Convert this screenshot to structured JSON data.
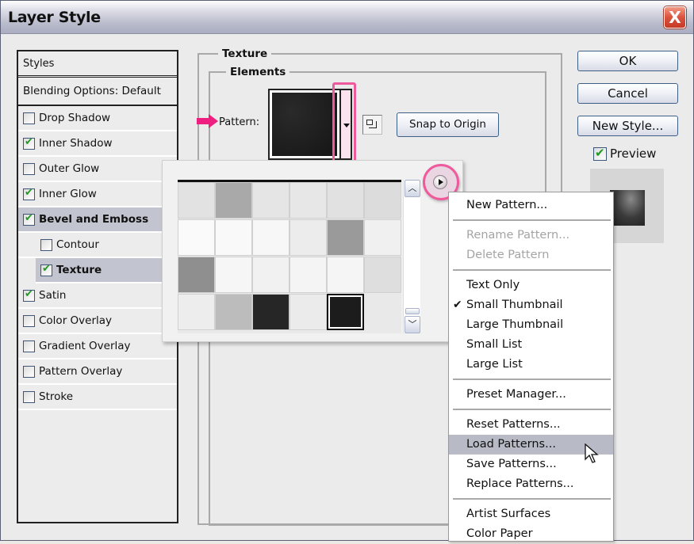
{
  "window": {
    "title": "Layer Style",
    "close_label": "X"
  },
  "styles_panel": {
    "header": "Styles",
    "blending": "Blending Options: Default",
    "items": [
      {
        "label": "Drop Shadow",
        "checked": false
      },
      {
        "label": "Inner Shadow",
        "checked": true
      },
      {
        "label": "Outer Glow",
        "checked": false
      },
      {
        "label": "Inner Glow",
        "checked": true
      },
      {
        "label": "Bevel and Emboss",
        "checked": true,
        "active": true
      },
      {
        "label": "Contour",
        "checked": false,
        "sub": true
      },
      {
        "label": "Texture",
        "checked": true,
        "sub": true,
        "active": true
      },
      {
        "label": "Satin",
        "checked": true
      },
      {
        "label": "Color Overlay",
        "checked": false
      },
      {
        "label": "Gradient Overlay",
        "checked": false
      },
      {
        "label": "Pattern Overlay",
        "checked": false
      },
      {
        "label": "Stroke",
        "checked": false
      }
    ]
  },
  "texture": {
    "group_title": "Texture",
    "elements_title": "Elements",
    "pattern_label": "Pattern:",
    "snap_button": "Snap to Origin",
    "highlight_color": "#ee5a9c"
  },
  "pattern_picker": {
    "rows": [
      [
        "#e2e2e2",
        "#a9a9a9",
        "#e5e5e5",
        "#e7e7e7",
        "#e1e1e1",
        "#dcdcdc"
      ],
      [
        "#fafafa",
        "#f9f9f9",
        "#f7f7f7",
        "#ececec",
        "#9a9a9a",
        "#f0f0f0"
      ],
      [
        "#8f8f8f",
        "#f6f6f6",
        "#f1f1f1",
        "#f4f4f4",
        "#f5f5f5",
        "#dedede"
      ],
      [
        "#ededed",
        "#bcbcbc",
        "#262626",
        "#ebebeb",
        "#1c1c1c",
        null
      ]
    ],
    "selected": {
      "row": 3,
      "col": 4
    }
  },
  "buttons": {
    "ok": "OK",
    "cancel": "Cancel",
    "new_style": "New Style...",
    "preview_label": "Preview",
    "preview_checked": true
  },
  "menu": {
    "items": [
      {
        "label": "New Pattern...",
        "type": "item"
      },
      {
        "type": "sep"
      },
      {
        "label": "Rename Pattern...",
        "type": "item",
        "disabled": true
      },
      {
        "label": "Delete Pattern",
        "type": "item",
        "disabled": true
      },
      {
        "type": "sep"
      },
      {
        "label": "Text Only",
        "type": "item"
      },
      {
        "label": "Small Thumbnail",
        "type": "item",
        "checked": true
      },
      {
        "label": "Large Thumbnail",
        "type": "item"
      },
      {
        "label": "Small List",
        "type": "item"
      },
      {
        "label": "Large List",
        "type": "item"
      },
      {
        "type": "sep"
      },
      {
        "label": "Preset Manager...",
        "type": "item"
      },
      {
        "type": "sep"
      },
      {
        "label": "Reset Patterns...",
        "type": "item"
      },
      {
        "label": "Load Patterns...",
        "type": "item",
        "highlighted": true
      },
      {
        "label": "Save Patterns...",
        "type": "item"
      },
      {
        "label": "Replace Patterns...",
        "type": "item"
      },
      {
        "type": "sep"
      },
      {
        "label": "Artist Surfaces",
        "type": "item"
      },
      {
        "label": "Color Paper",
        "type": "item"
      }
    ]
  }
}
